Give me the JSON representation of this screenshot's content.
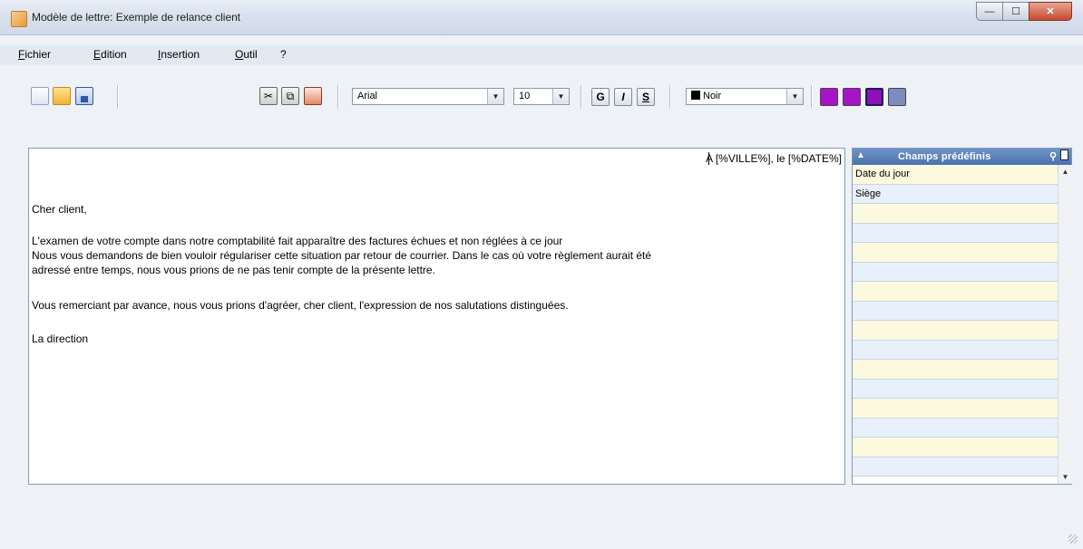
{
  "window": {
    "title": "Modèle de lettre: Exemple de relance client",
    "controls": {
      "minimize": "—",
      "maximize": "☐",
      "close": "✕"
    }
  },
  "menu": {
    "items": [
      {
        "key": "F",
        "rest": "ichier"
      },
      {
        "key": "E",
        "rest": "dition"
      },
      {
        "key": "I",
        "rest": "nsertion"
      },
      {
        "key": "O",
        "rest": "util"
      },
      {
        "key": "",
        "rest": "?"
      }
    ]
  },
  "toolbar": {
    "font_family": "Arial",
    "font_size": "10",
    "bold_label": "G",
    "italic_label": "I",
    "underline_label": "S",
    "color_label": "Noir",
    "icons": [
      "new-document-icon",
      "open-folder-icon",
      "save-icon",
      "cut-icon",
      "copy-icon",
      "paste-icon"
    ],
    "colors": {
      "swatch": "#000000",
      "align1": "#a614c8",
      "align2": "#a614c8",
      "align3": "#8c10b8",
      "align4": "#7a8cc0"
    }
  },
  "editor": {
    "header_right": "A [%VILLE%], le [%DATE%]",
    "greeting": "Cher client,",
    "para1_line1": "L'examen de votre compte dans notre comptabilité fait apparaître des factures échues et non réglées à ce jour",
    "para1_line2": "Nous vous demandons de bien vouloir régulariser cette situation par retour de courrier. Dans le cas où votre règlement aurait été",
    "para1_line3": "adressé entre temps, nous vous prions de ne pas tenir compte de la présente lettre.",
    "para2": "Vous remerciant par avance, nous vous prions d'agréer, cher client, l'expression de nos salutations distinguées.",
    "signature": "La direction"
  },
  "panel": {
    "title": "Champs prédéfinis",
    "fields": [
      "Date du jour",
      "Siège",
      "",
      "",
      "",
      "",
      "",
      "",
      "",
      "",
      "",
      "",
      "",
      "",
      "",
      ""
    ]
  }
}
